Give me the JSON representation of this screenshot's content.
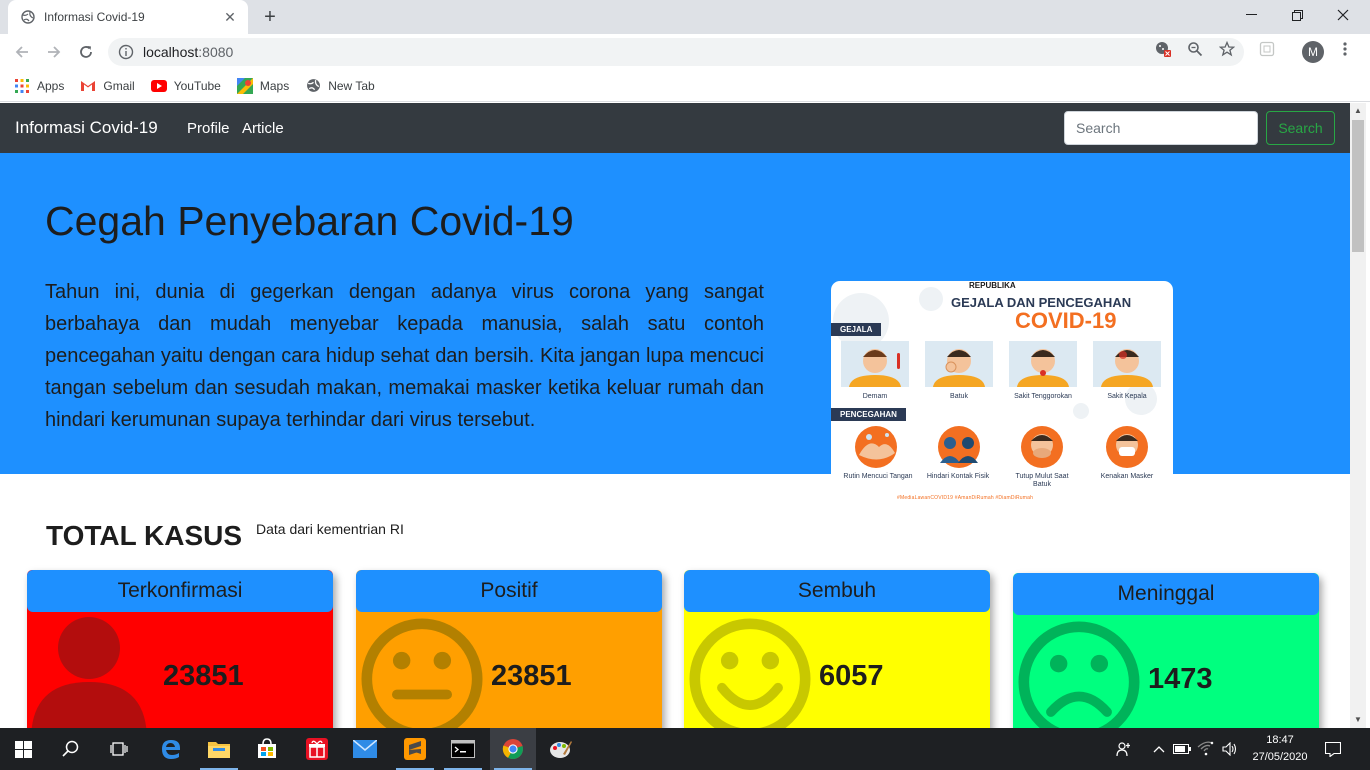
{
  "browser": {
    "tab_title": "Informasi Covid-19",
    "url_host": "localhost",
    "url_port": ":8080",
    "profile_initial": "M",
    "bookmarks": [
      "Apps",
      "Gmail",
      "YouTube",
      "Maps",
      "New Tab"
    ]
  },
  "navbar": {
    "brand": "Informasi Covid-19",
    "links": [
      "Profile",
      "Article"
    ],
    "search_placeholder": "Search",
    "search_button": "Search"
  },
  "hero": {
    "title": "Cegah Penyebaran Covid-19",
    "text": "Tahun ini, dunia di gegerkan dengan adanya virus corona yang sangat berbahaya dan mudah menyebar kepada manusia, salah satu contoh pencegahan yaitu dengan cara hidup sehat dan bersih. Kita jangan lupa mencuci tangan sebelum dan sesudah makan, memakai masker ketika keluar rumah dan hindari kerumunan supaya terhindar dari virus tersebut.",
    "poster": {
      "brand": "REPUBLIKA",
      "heading1": "GEJALA DAN PENCEGAHAN",
      "heading2": "COVID-19",
      "tag_gejala": "GEJALA",
      "tag_pencegahan": "PENCEGAHAN",
      "gejala": [
        "Demam",
        "Batuk",
        "Sakit Tenggorokan",
        "Sakit Kepala"
      ],
      "pencegahan": [
        "Rutin Mencuci Tangan",
        "Hindari Kontak Fisik",
        "Tutup Mulut Saat Batuk",
        "Kenakan Masker"
      ],
      "footer": "#MediaLawanCOVID19   #AmanDiRumah   #DiamDiRumah"
    }
  },
  "section": {
    "title": "TOTAL KASUS",
    "subtitle": "Data dari kementrian RI"
  },
  "cards": [
    {
      "label": "Terkonfirmasi",
      "value": "23851",
      "color": "#ff0000",
      "icon": "person-icon"
    },
    {
      "label": "Positif",
      "value": "23851",
      "color": "#ff9f00",
      "icon": "neutral-face-icon"
    },
    {
      "label": "Sembuh",
      "value": "6057",
      "color": "#ffff00",
      "icon": "smile-face-icon"
    },
    {
      "label": "Meninggal",
      "value": "1473",
      "color": "#00ff7f",
      "icon": "sad-face-icon"
    }
  ],
  "taskbar": {
    "time": "18:47",
    "date": "27/05/2020"
  }
}
